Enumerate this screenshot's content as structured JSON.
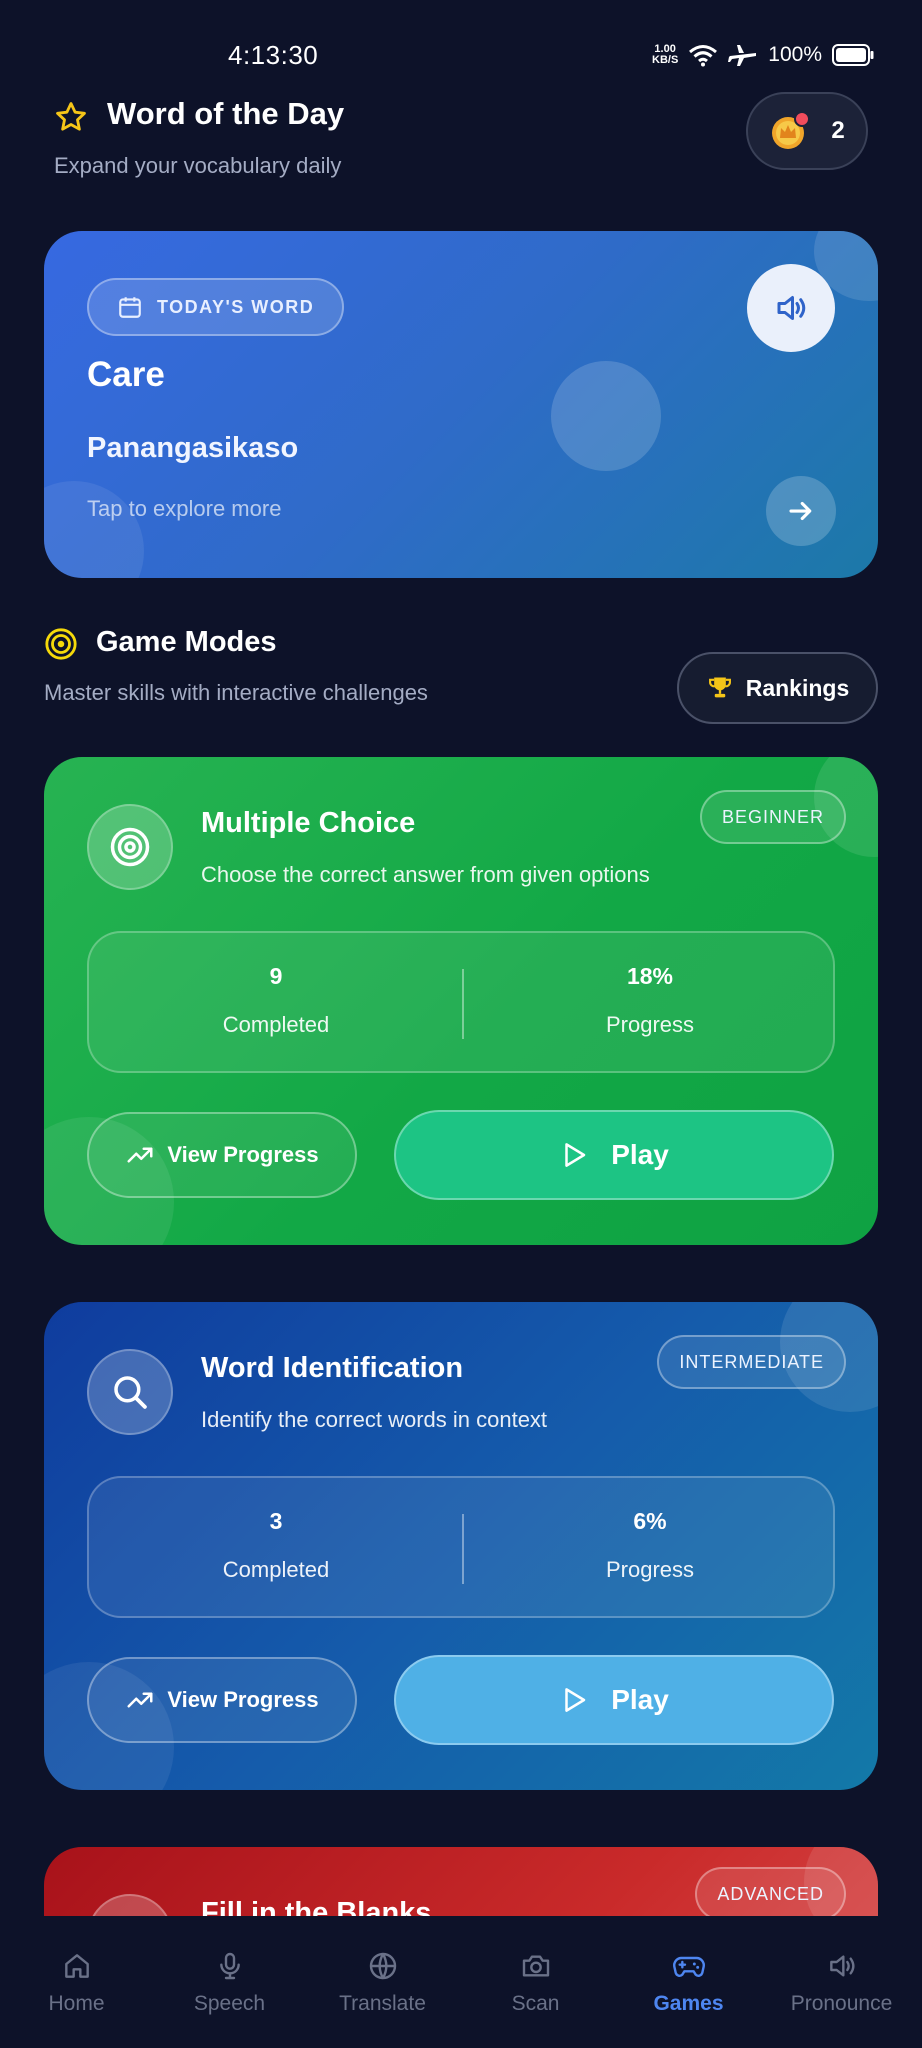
{
  "status_bar": {
    "time": "4:13:30",
    "net_speed_top": "1.00",
    "net_speed_bottom": "KB/S",
    "battery": "100%"
  },
  "header": {
    "title": "Word of the Day",
    "subtitle": "Expand your vocabulary daily",
    "streak_count": "2"
  },
  "word_card": {
    "badge": "TODAY'S WORD",
    "word": "Care",
    "translation": "Panangasikaso",
    "hint": "Tap to explore more"
  },
  "game_modes": {
    "title": "Game Modes",
    "subtitle": "Master skills with interactive challenges",
    "rankings_label": "Rankings"
  },
  "modes": [
    {
      "title": "Multiple Choice",
      "description": "Choose the correct answer from given options",
      "level": "BEGINNER",
      "completed_value": "9",
      "completed_label": "Completed",
      "progress_value": "18%",
      "progress_label": "Progress",
      "view_progress_label": "View Progress",
      "play_label": "Play"
    },
    {
      "title": "Word Identification",
      "description": "Identify the correct words in context",
      "level": "INTERMEDIATE",
      "completed_value": "3",
      "completed_label": "Completed",
      "progress_value": "6%",
      "progress_label": "Progress",
      "view_progress_label": "View Progress",
      "play_label": "Play"
    },
    {
      "title": "Fill in the Blanks",
      "level": "ADVANCED"
    }
  ],
  "nav": {
    "items": [
      {
        "label": "Home",
        "icon": "home-icon"
      },
      {
        "label": "Speech",
        "icon": "microphone-icon"
      },
      {
        "label": "Translate",
        "icon": "globe-icon"
      },
      {
        "label": "Scan",
        "icon": "camera-icon"
      },
      {
        "label": "Games",
        "icon": "gamepad-icon"
      },
      {
        "label": "Pronounce",
        "icon": "speaker-icon"
      }
    ],
    "active": "Games"
  },
  "colors": {
    "background": "#0d1229",
    "accent": "#4e86f0",
    "green_card": "#12a846",
    "blue_card": "#155bab",
    "red_card": "#c92a2a",
    "star": "#f5c518"
  }
}
